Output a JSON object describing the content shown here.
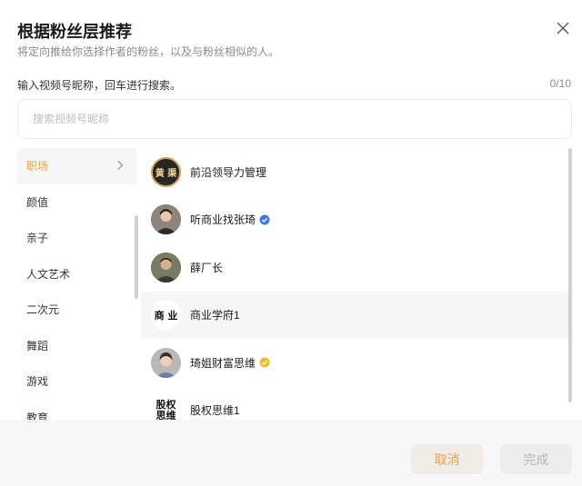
{
  "dialog": {
    "title": "根据粉丝层推荐",
    "subtitle": "将定向推给你选择作者的粉丝，以及与粉丝相似的人。",
    "prompt": "输入视频号昵称，回车进行搜索。",
    "counter": "0/10"
  },
  "search": {
    "placeholder": "搜索视频号昵称",
    "value": ""
  },
  "categories": [
    {
      "label": "职场",
      "active": true
    },
    {
      "label": "颜值"
    },
    {
      "label": "亲子"
    },
    {
      "label": "人文艺术"
    },
    {
      "label": "二次元"
    },
    {
      "label": "舞蹈"
    },
    {
      "label": "游戏"
    },
    {
      "label": "教育"
    }
  ],
  "accounts": [
    {
      "name": "前沿领导力管理",
      "avatar_text": "黄 渠",
      "verified": null
    },
    {
      "name": "听商业找张琦",
      "avatar_text": "",
      "verified": "blue"
    },
    {
      "name": "薛厂长",
      "avatar_text": "",
      "verified": null
    },
    {
      "name": "商业学府1",
      "avatar_text": "商 业",
      "verified": null
    },
    {
      "name": "琦姐财富思维",
      "avatar_text": "",
      "verified": "yellow"
    },
    {
      "name": "股权思维1",
      "avatar_text": "股权 思维",
      "verified": null
    }
  ],
  "buttons": {
    "cancel": "取消",
    "done": "完成"
  },
  "colors": {
    "accent": "#fa9d3b",
    "verified_blue": "#3d78e6",
    "verified_yellow": "#f2b830"
  },
  "icons": {
    "close": "close-icon",
    "chevron": "chevron-right-icon",
    "verified": "verified-badge-icon"
  }
}
